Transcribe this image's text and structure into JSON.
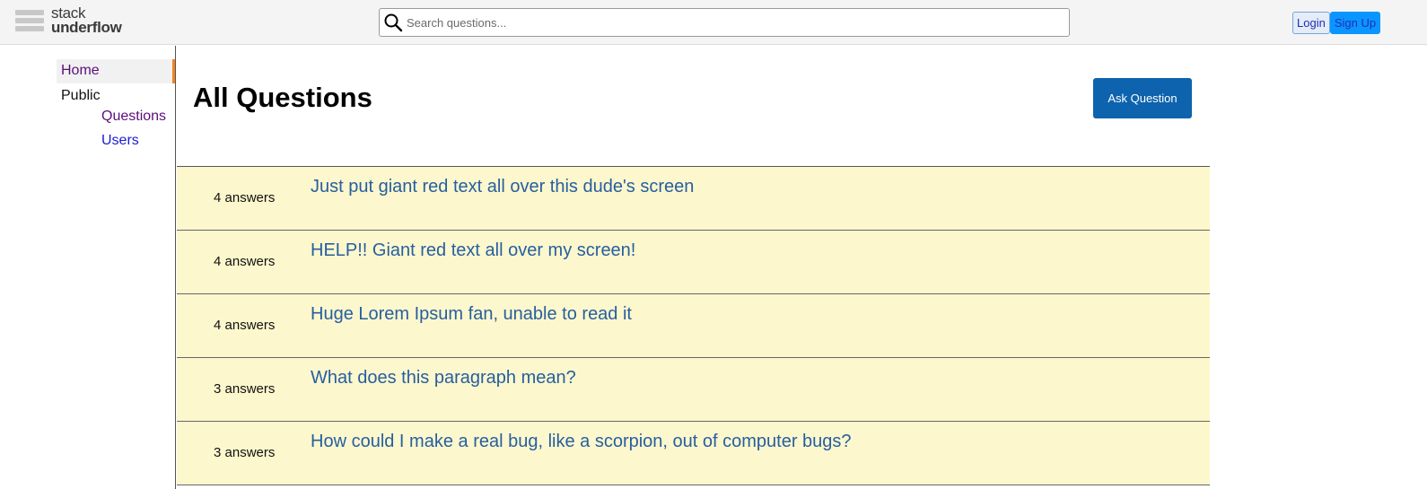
{
  "header": {
    "logo_line1": "stack",
    "logo_line2": "underflow",
    "search_placeholder": "Search questions...",
    "login_label": "Login",
    "signup_label": "Sign Up"
  },
  "sidebar": {
    "home": "Home",
    "public": "Public",
    "questions": "Questions",
    "users": "Users"
  },
  "main": {
    "title": "All Questions",
    "ask_button": "Ask Question",
    "questions": [
      {
        "answers": "4 answers",
        "title": "Just put giant red text all over this dude's screen"
      },
      {
        "answers": "4 answers",
        "title": "HELP!! Giant red text all over my screen!"
      },
      {
        "answers": "4 answers",
        "title": "Huge Lorem Ipsum fan, unable to read it"
      },
      {
        "answers": "3 answers",
        "title": "What does this paragraph mean?"
      },
      {
        "answers": "3 answers",
        "title": "How could I make a real bug, like a scorpion, out of computer bugs?"
      }
    ]
  },
  "colors": {
    "accent_orange": "#f48225",
    "ask_button_blue": "#0d63ad",
    "question_row_bg": "#fdf7cd",
    "question_link": "#265fa0"
  }
}
